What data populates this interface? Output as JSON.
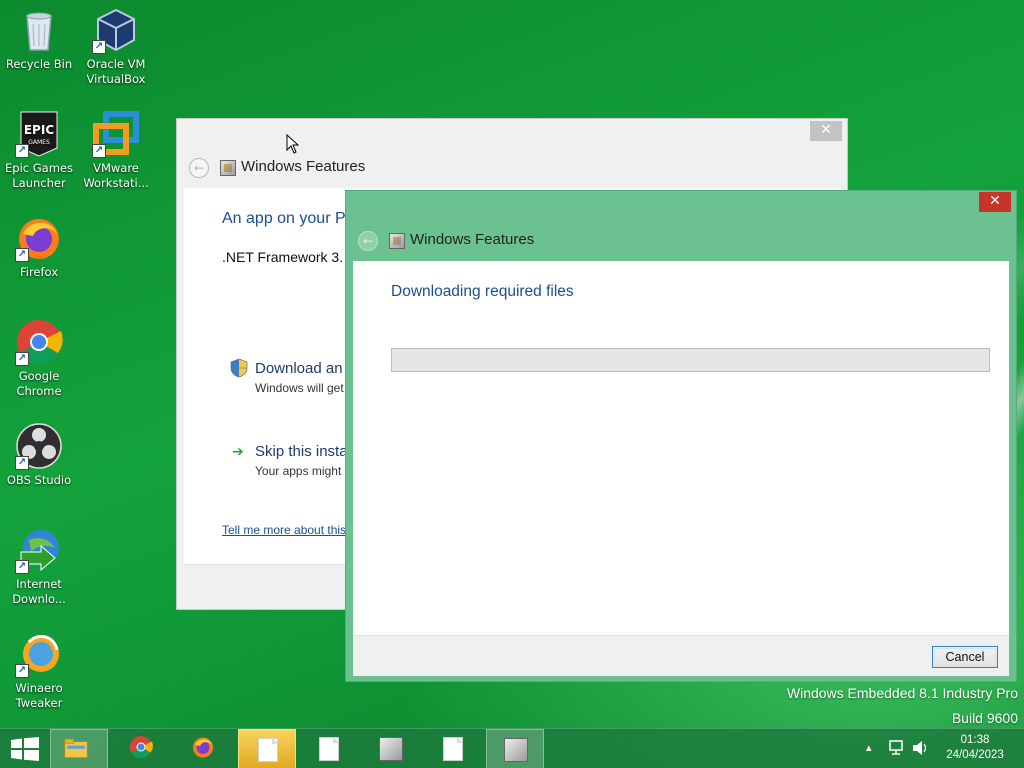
{
  "desktop": {
    "icons": [
      {
        "label": "Recycle Bin",
        "icon": "recycle-bin-icon"
      },
      {
        "label": "Oracle VM VirtualBox",
        "icon": "virtualbox-icon"
      },
      {
        "label": "Epic Games Launcher",
        "icon": "epic-games-icon"
      },
      {
        "label": "VMware Workstati...",
        "icon": "vmware-icon"
      },
      {
        "label": "Firefox",
        "icon": "firefox-icon"
      },
      {
        "label": "Google Chrome",
        "icon": "chrome-icon"
      },
      {
        "label": "OBS Studio",
        "icon": "obs-icon"
      },
      {
        "label": "Internet Downlo...",
        "icon": "internet-download-manager-icon"
      },
      {
        "label": "Winaero Tweaker",
        "icon": "winaero-icon"
      }
    ],
    "watermark_line1": "Windows Embedded 8.1 Industry Pro",
    "watermark_line2": "Build 9600"
  },
  "back_window": {
    "title": "Windows Features",
    "heading": "An app on your PC",
    "subtext": ".NET Framework 3.",
    "option1_title": "Download an",
    "option1_desc": "Windows will get",
    "option2_title": "Skip this insta",
    "option2_desc": "Your apps might",
    "link": "Tell me more about this",
    "close_glyph": "✕"
  },
  "front_window": {
    "title": "Windows Features",
    "heading": "Downloading required files",
    "progress": 0,
    "cancel_label": "Cancel",
    "close_glyph": "✕"
  },
  "taskbar": {
    "items": [
      "start-button",
      "file-explorer",
      "chrome",
      "firefox",
      "document-highlighted",
      "document",
      "windows-features",
      "document-2",
      "windows-features-active"
    ],
    "clock_time": "01:38",
    "clock_date": "24/04/2023",
    "tray_expand": "▴"
  },
  "colors": {
    "desktop": "#14a23c",
    "dialog_frame": "#6cc191",
    "heading_blue": "#1c4f8f",
    "close_red": "#c7342b"
  }
}
